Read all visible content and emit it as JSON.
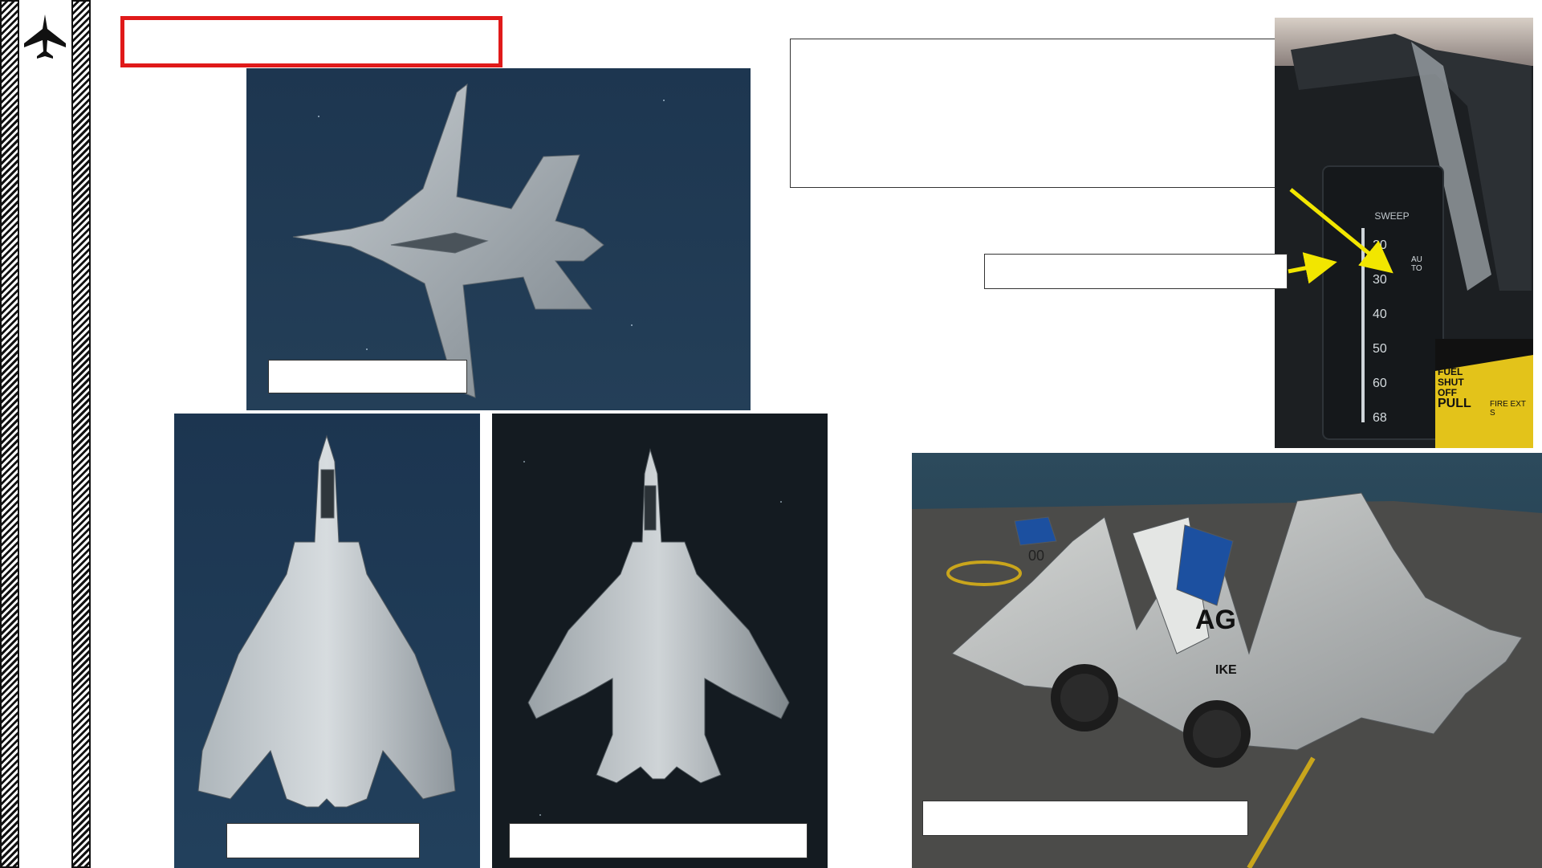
{
  "header": {
    "title": "",
    "description": ""
  },
  "icons": {
    "logo": "jet-silhouette-icon"
  },
  "gauge": {
    "heading": "SWEEP",
    "ticks": [
      "20",
      "30",
      "40",
      "50",
      "60",
      "68"
    ],
    "auto_label": "AUTO",
    "fuel_label_1": "FUEL",
    "fuel_label_2": "SHUT",
    "fuel_label_3": "OFF",
    "fuel_label_4": "PULL",
    "fire_label": "FIRE EXT S"
  },
  "aircraft": {
    "tail_letters": "AG",
    "tail_sub": "IKE",
    "modex": "00"
  },
  "captions": {
    "top_image": "",
    "bottom_left_image": "",
    "bottom_middle_image": "",
    "carrier_image": "",
    "gauge_pointer": ""
  },
  "colors": {
    "title_border": "#e01a1a",
    "arrow": "#f2e600",
    "sky_top": "#1f3a55",
    "sky_dark": "#141c22",
    "sea": "#1e3d52",
    "deck": "#4a4a48"
  }
}
